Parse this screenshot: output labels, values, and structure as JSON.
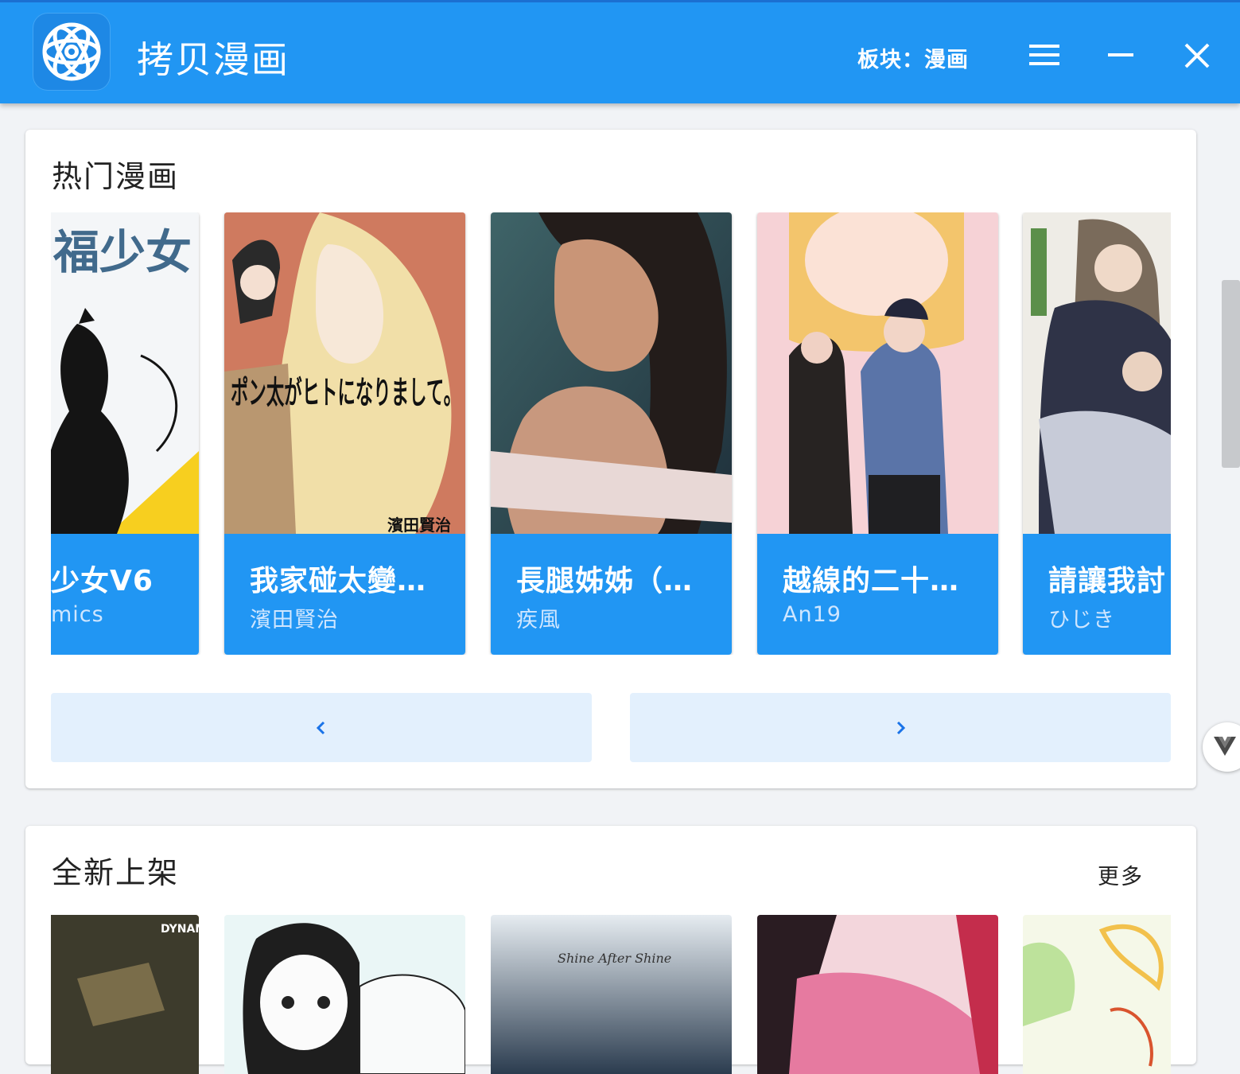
{
  "window": {
    "app_title": "拷贝漫画",
    "section_label": "板块：漫画",
    "accent_color": "#2196f3",
    "icons": [
      "app-logo",
      "menu-icon",
      "minimize-icon",
      "close-icon"
    ]
  },
  "hot": {
    "title": "热门漫画",
    "items": [
      {
        "title": "少女V6",
        "author": "mics"
      },
      {
        "title": "我家碰太變…",
        "author": "濱田賢治"
      },
      {
        "title": "長腿姊姊（…",
        "author": "疾風"
      },
      {
        "title": "越線的二十…",
        "author": "An19"
      },
      {
        "title": "請讓我討",
        "author": "ひじき"
      }
    ],
    "cover_texts": {
      "cover1": "福少女",
      "cover2_main": "ポン太がヒトになりまして。",
      "cover2_author": "濱田賢治"
    },
    "prev_icon": "chevron-left-icon",
    "next_icon": "chevron-right-icon"
  },
  "new_release": {
    "title": "全新上架",
    "more_label": "更多",
    "cover_texts": {
      "cover1": "DYNAMITE",
      "cover3": "Shine After Shine"
    }
  }
}
